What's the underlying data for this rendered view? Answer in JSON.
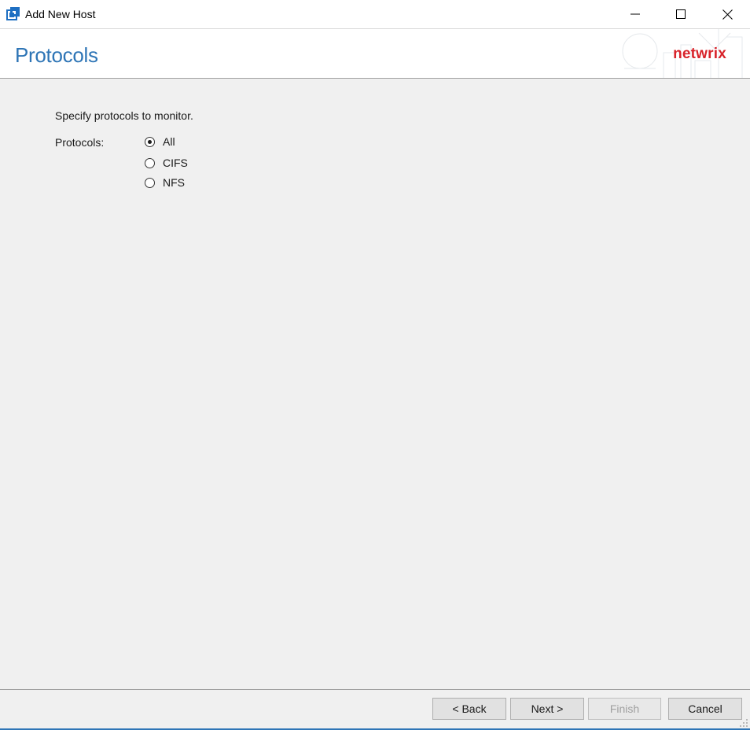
{
  "window": {
    "title": "Add New Host",
    "controls": {
      "minimize": "minimize-icon",
      "maximize": "maximize-icon",
      "close": "close-icon"
    }
  },
  "header": {
    "title": "Protocols",
    "brand": "netwrix"
  },
  "content": {
    "instruction": "Specify protocols to monitor.",
    "protocols_label": "Protocols:",
    "options": [
      {
        "label": "All",
        "checked": true
      },
      {
        "label": "CIFS",
        "checked": false
      },
      {
        "label": "NFS",
        "checked": false
      }
    ]
  },
  "footer": {
    "back_label": "< Back",
    "next_label": "Next >",
    "finish_label": "Finish",
    "finish_enabled": false,
    "cancel_label": "Cancel"
  },
  "colors": {
    "title_blue": "#2e75b6",
    "brand_red": "#d8232a",
    "background": "#f0f0f0"
  }
}
